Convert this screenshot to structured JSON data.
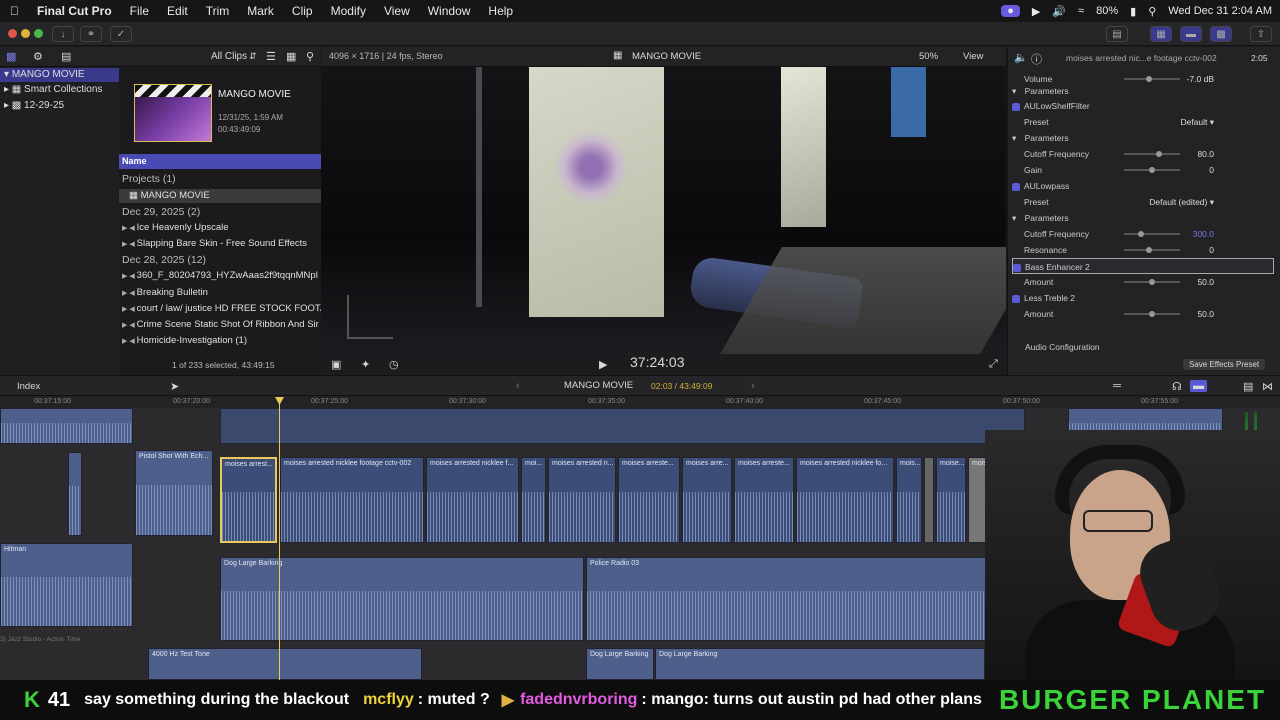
{
  "menubar": {
    "app": "Final Cut Pro",
    "items": [
      "File",
      "Edit",
      "Trim",
      "Mark",
      "Clip",
      "Modify",
      "View",
      "Window",
      "Help"
    ],
    "battery": "80%",
    "clock": "Wed Dec 31  2:04 AM"
  },
  "library": {
    "filter": "All Clips",
    "items": [
      {
        "label": "MANGO MOVIE"
      },
      {
        "label": "Smart Collections"
      },
      {
        "label": "12-29-25"
      }
    ]
  },
  "event": {
    "title": "MANGO MOVIE",
    "date": "12/31/25, 1:59 AM",
    "duration": "00:43:49:09"
  },
  "browser": {
    "column": "Name",
    "rows": [
      {
        "label": "Projects  (1)",
        "kind": "group"
      },
      {
        "label": "MANGO MOVIE",
        "kind": "selected"
      },
      {
        "label": "Dec 29, 2025  (2)",
        "kind": "group"
      },
      {
        "label": "Ice Heavenly Upscale",
        "kind": "item"
      },
      {
        "label": "Slapping Bare Skin - Free Sound Effects",
        "kind": "item"
      },
      {
        "label": "Dec 28, 2025  (12)",
        "kind": "group"
      },
      {
        "label": "360_F_80204793_HYZwAaas2f9tqqnMNpl",
        "kind": "item"
      },
      {
        "label": "Breaking Bulletin",
        "kind": "item"
      },
      {
        "label": "court / law/ justice HD FREE STOCK FOOTA",
        "kind": "item"
      },
      {
        "label": "Crime Scene Static Shot Of Ribbon And Sir",
        "kind": "item"
      },
      {
        "label": "Homicide-Investigation (1)",
        "kind": "item"
      }
    ],
    "footer": "1 of 233 selected, 43:49:15"
  },
  "viewer": {
    "format": "4096 × 1716 | 24 fps, Stereo",
    "title": "MANGO MOVIE",
    "zoom": "50%",
    "view": "View",
    "timecode": "37:24:03"
  },
  "inspector": {
    "clip_name": "moises arrested nic...e footage cctv-002",
    "clip_duration": "2:05",
    "rows": [
      {
        "label": "Volume",
        "value": "-7.0 dB",
        "kind": "param",
        "knob": 0.45
      },
      {
        "label": "Parameters",
        "value": "",
        "kind": "section"
      },
      {
        "label": "AULowShelfFilter",
        "value": "",
        "kind": "effect"
      },
      {
        "label": "Preset",
        "value": "Default ▾",
        "kind": "param",
        "knob": -1
      },
      {
        "label": "Parameters",
        "value": "",
        "kind": "section"
      },
      {
        "label": "Cutoff Frequency",
        "value": "80.0",
        "kind": "param",
        "knob": 0.62
      },
      {
        "label": "Gain",
        "value": "0",
        "kind": "param",
        "knob": 0.5
      },
      {
        "label": "AULowpass",
        "value": "",
        "kind": "effect"
      },
      {
        "label": "Preset",
        "value": "Default (edited) ▾",
        "kind": "param",
        "knob": -1
      },
      {
        "label": "Parameters",
        "value": "",
        "kind": "section"
      },
      {
        "label": "Cutoff Frequency",
        "value": "300.0",
        "kind": "param",
        "knob": 0.3
      },
      {
        "label": "Resonance",
        "value": "0",
        "kind": "param",
        "knob": 0.45
      },
      {
        "label": "Bass Enhancer 2",
        "value": "",
        "kind": "effect-sel"
      },
      {
        "label": "Amount",
        "value": "50.0",
        "kind": "param",
        "knob": 0.5
      },
      {
        "label": "Less Treble 2",
        "value": "",
        "kind": "effect"
      },
      {
        "label": "Amount",
        "value": "50.0",
        "kind": "param",
        "knob": 0.5
      }
    ],
    "audio_config": "Audio Configuration",
    "save_preset": "Save Effects Preset"
  },
  "timeline_bar": {
    "index": "Index",
    "project": "MANGO MOVIE",
    "position": "02:03 / 43:49:09"
  },
  "ruler_ticks": [
    "00:37:15:00",
    "00:37:20:00",
    "00:37:25:00",
    "00:37:30:00",
    "00:37:35:00",
    "00:37:40:00",
    "00:37:45:00",
    "00:37:50:00",
    "00:37:55:00"
  ],
  "clips": {
    "pistol": "Pistol Shot With Ech...",
    "sel": "moises arrest...",
    "c1": "moises arrested nicklee footage cctv-002",
    "c2": "moises arrested nicklee f...",
    "c3": "moi...",
    "c4": "moises arrested n...",
    "c5": "moises arreste...",
    "c6": "moises arre...",
    "c7": "moises arreste...",
    "c8": "moises arrested nicklee fo...",
    "c9": "mois...",
    "c10": "moise...",
    "c11": "mois...",
    "hitman": "Hitman",
    "dog1": "Dog Large Barking",
    "police": "Police Radio 03",
    "test": "4000 Hz Test Tone",
    "dog2": "Dog Large Barking",
    "dog3": "Dog Large Barking",
    "studio": "3) Jazz Studio - Action Time"
  },
  "ticker": {
    "k": "K",
    "count": "41",
    "msg0": "say something during the blackout",
    "user1": "mcflyy",
    "msg1": ": muted ?",
    "user2": "fadednvrboring",
    "msg2": ": mango: turns out austin pd had other plans",
    "brand": "BURGER PLANET"
  },
  "colors": {
    "accent": "#5a5ad6",
    "selection": "#3a3a8c",
    "clip": "#4d5f8a",
    "playhead": "#e8c95a",
    "ticker_user": "#f0d33a"
  }
}
